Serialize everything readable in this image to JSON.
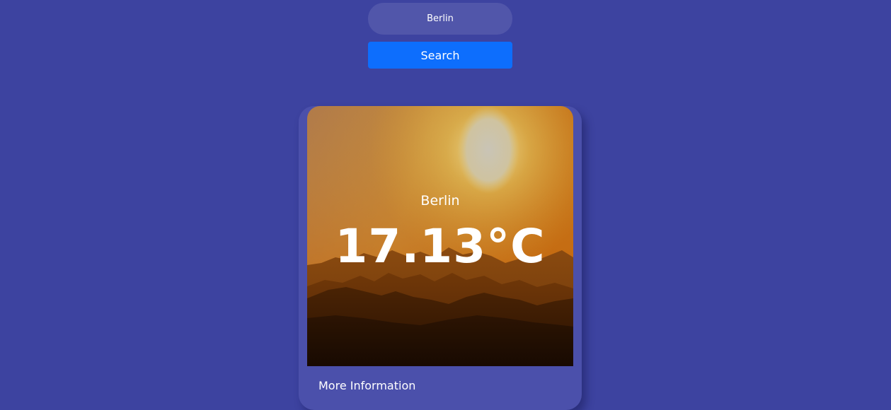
{
  "search": {
    "input_value": "Berlin",
    "button_label": "Search"
  },
  "weather_card": {
    "city": "Berlin",
    "temperature": "17.13°C",
    "more_info_label": "More Information",
    "image_icon": "sunset-mountains-image"
  },
  "colors": {
    "background": "#3d43a0",
    "card": "#4b50ab",
    "input": "#5156aa",
    "button": "#0d6efd"
  }
}
